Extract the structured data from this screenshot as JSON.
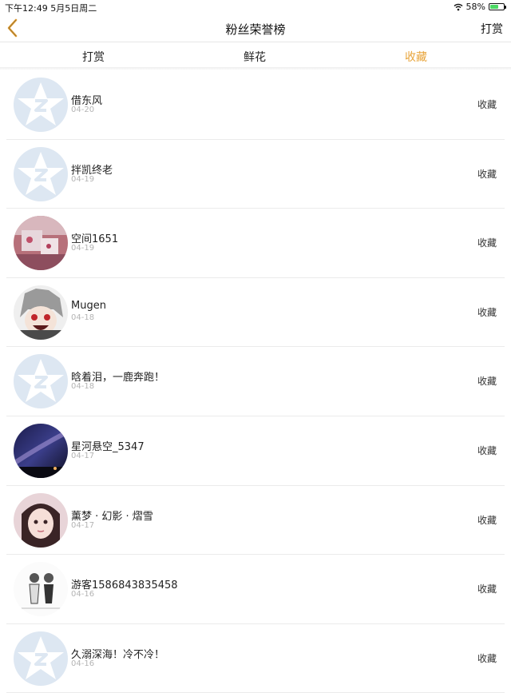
{
  "status_bar": {
    "time_date": "下午12:49   5月5日周二",
    "battery": "58%"
  },
  "nav": {
    "title": "粉丝荣誉榜",
    "right_label": "打赏"
  },
  "tabs": [
    {
      "label": "打赏",
      "active": false
    },
    {
      "label": "鲜花",
      "active": false
    },
    {
      "label": "收藏",
      "active": true
    }
  ],
  "colors": {
    "accent": "#e8a43a",
    "placeholder": "#dde7f2"
  },
  "items": [
    {
      "name": "借东风",
      "date": "04-20",
      "action": "收藏",
      "avatar": "default-avatar-icon"
    },
    {
      "name": "拌凯终老",
      "date": "04-19",
      "action": "收藏",
      "avatar": "default-avatar-icon"
    },
    {
      "name": "空间1651",
      "date": "04-19",
      "action": "收藏",
      "avatar": "photo-avatar"
    },
    {
      "name": "Mugen",
      "date": "04-18",
      "action": "收藏",
      "avatar": "anime-avatar"
    },
    {
      "name": "晗着泪，一鹿奔跑！",
      "date": "04-18",
      "action": "收藏",
      "avatar": "default-avatar-icon"
    },
    {
      "name": "星河悬空_5347",
      "date": "04-17",
      "action": "收藏",
      "avatar": "galaxy-avatar"
    },
    {
      "name": "薰梦 · 幻影 · 熠雪",
      "date": "04-17",
      "action": "收藏",
      "avatar": "girl-avatar"
    },
    {
      "name": "游客1586843835458",
      "date": "04-16",
      "action": "收藏",
      "avatar": "sketch-avatar"
    },
    {
      "name": "久溺深海！冷不冷！",
      "date": "04-16",
      "action": "收藏",
      "avatar": "default-avatar-icon"
    }
  ]
}
